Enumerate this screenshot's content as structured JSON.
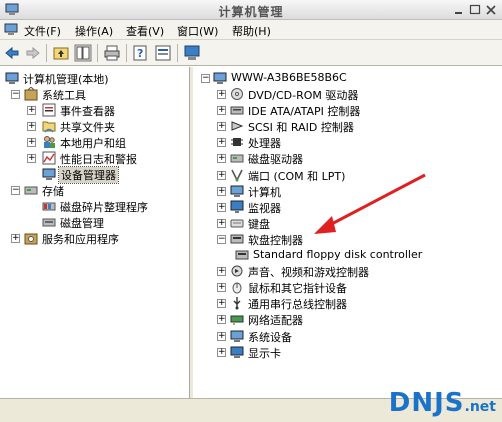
{
  "window": {
    "title": "计算机管理"
  },
  "menu": [
    {
      "label": "文件(F)"
    },
    {
      "label": "操作(A)"
    },
    {
      "label": "查看(V)"
    },
    {
      "label": "窗口(W)"
    },
    {
      "label": "帮助(H)"
    }
  ],
  "left_tree": {
    "root": "计算机管理(本地)",
    "system_tools": "系统工具",
    "event_viewer": "事件查看器",
    "shared_folders": "共享文件夹",
    "local_users": "本地用户和组",
    "perf_logs": "性能日志和警报",
    "device_manager": "设备管理器",
    "storage": "存储",
    "defrag": "磁盘碎片整理程序",
    "disk_mgmt": "磁盘管理",
    "services": "服务和应用程序"
  },
  "right_tree": {
    "computer": "WWW-A3B6BE58B6C",
    "devices": [
      {
        "label": "DVD/CD-ROM 驱动器",
        "icon": "cdrom-icon",
        "exp": "+"
      },
      {
        "label": "IDE ATA/ATAPI 控制器",
        "icon": "ide-icon",
        "exp": "+"
      },
      {
        "label": "SCSI 和 RAID 控制器",
        "icon": "scsi-icon",
        "exp": "+"
      },
      {
        "label": "处理器",
        "icon": "cpu-icon",
        "exp": "+"
      },
      {
        "label": "磁盘驱动器",
        "icon": "disk-icon",
        "exp": "+"
      },
      {
        "label": "端口 (COM 和 LPT)",
        "icon": "port-icon",
        "exp": "+"
      },
      {
        "label": "计算机",
        "icon": "computer-icon",
        "exp": "+"
      },
      {
        "label": "监视器",
        "icon": "monitor-icon",
        "exp": "+"
      },
      {
        "label": "键盘",
        "icon": "keyboard-icon",
        "exp": "+"
      },
      {
        "label": "软盘控制器",
        "icon": "floppy-controller-icon",
        "exp": "−"
      },
      {
        "label": "Standard floppy disk controller",
        "icon": "floppy-controller-icon",
        "exp": "",
        "child": true
      },
      {
        "label": "声音、视频和游戏控制器",
        "icon": "sound-icon",
        "exp": "+"
      },
      {
        "label": "鼠标和其它指针设备",
        "icon": "mouse-icon",
        "exp": "+"
      },
      {
        "label": "通用串行总线控制器",
        "icon": "usb-icon",
        "exp": "+"
      },
      {
        "label": "网络适配器",
        "icon": "network-icon",
        "exp": "+"
      },
      {
        "label": "系统设备",
        "icon": "system-device-icon",
        "exp": "+"
      },
      {
        "label": "显示卡",
        "icon": "display-icon",
        "exp": "+"
      }
    ]
  },
  "watermark": {
    "text": "DNJS",
    "suffix": ".net"
  },
  "colors": {
    "arrow": "#e02020",
    "watermark": "#1a73c9",
    "selection": "#d8d4c8"
  }
}
